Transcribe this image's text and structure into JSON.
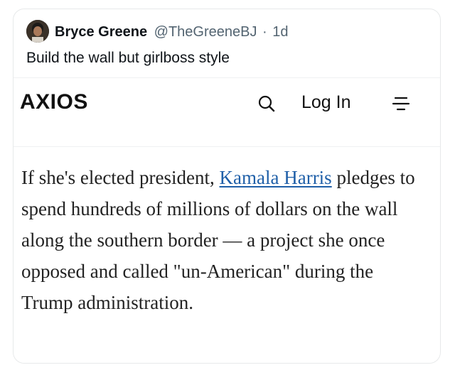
{
  "tweet": {
    "author_name": "Bryce Greene",
    "handle": "@TheGreeneBJ",
    "separator": "·",
    "time": "1d",
    "text": "Build the wall but girlboss style"
  },
  "site": {
    "logo": "AXIOS",
    "search_icon": "search-icon",
    "login_label": "Log In",
    "menu_icon": "menu-icon"
  },
  "article": {
    "text_before": "If she's elected president, ",
    "link_text": "Kamala Harris",
    "text_after": " pledges to spend hundreds of millions of dollars on the wall along the southern border — a project she once opposed and called \"un-American\" during the Trump administration.",
    "link_color": "#1f5fa8"
  }
}
